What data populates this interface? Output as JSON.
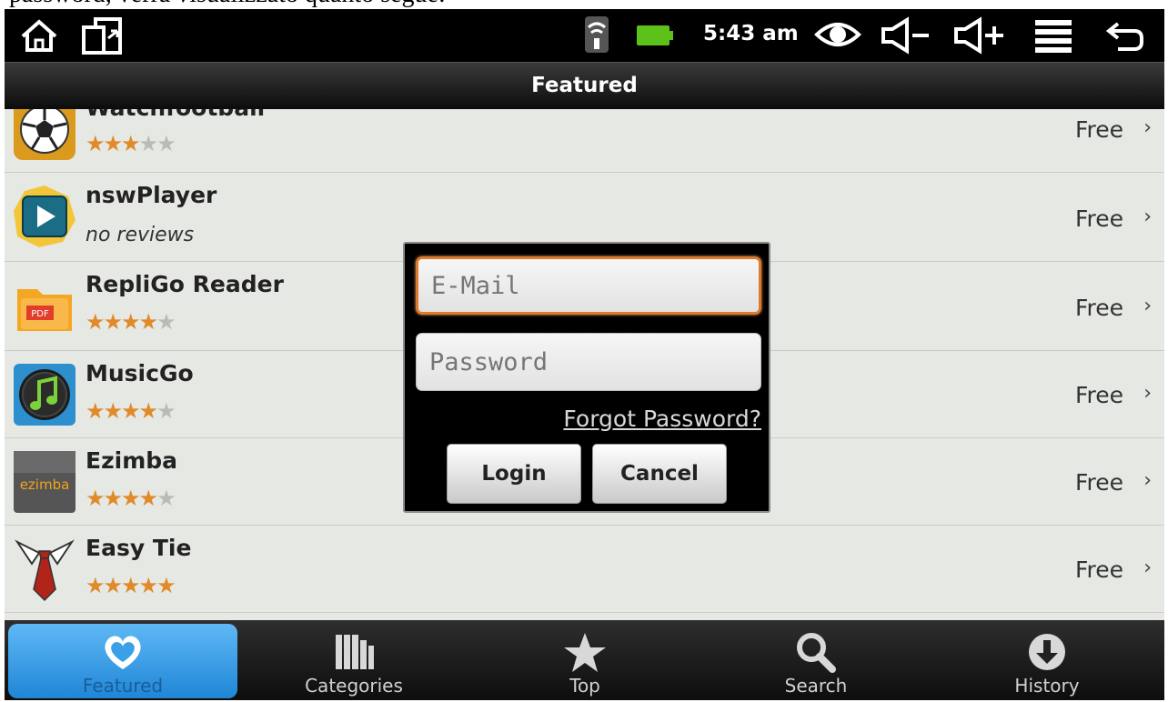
{
  "caption": "password, verrà visualizzato quanto segue:",
  "status": {
    "time": "5:43 am",
    "icons": [
      "home-icon",
      "recent-apps-icon",
      "wifi-icon",
      "battery-icon",
      "eye-icon",
      "volume-down-icon",
      "volume-up-icon",
      "menu-icon",
      "back-icon"
    ]
  },
  "title": "Featured",
  "apps": [
    {
      "name": "Watchfootball",
      "sub": "",
      "rating": 3,
      "price": "Free",
      "chevron": "›",
      "icon": "football-icon"
    },
    {
      "name": "nswPlayer",
      "sub": "no reviews",
      "rating": 0,
      "price": "Free",
      "chevron": "›",
      "icon": "play-icon"
    },
    {
      "name": "RepliGo Reader",
      "sub": "",
      "rating": 4,
      "price": "Free",
      "chevron": "›",
      "icon": "pdf-folder-icon",
      "icon_text": "PDF"
    },
    {
      "name": "MusicGo",
      "sub": "",
      "rating": 4,
      "price": "Free",
      "chevron": "›",
      "icon": "music-note-icon"
    },
    {
      "name": "Ezimba",
      "sub": "",
      "rating": 4,
      "price": "Free",
      "chevron": "›",
      "icon": "ezimba-logo-icon",
      "icon_text": "ezimba"
    },
    {
      "name": "Easy Tie",
      "sub": "",
      "rating": 5,
      "price": "Free",
      "chevron": "›",
      "icon": "tie-icon"
    }
  ],
  "login": {
    "email_placeholder": "E-Mail",
    "email_value": "",
    "password_placeholder": "Password",
    "password_value": "",
    "forgot": "Forgot Password?",
    "login_label": "Login",
    "cancel_label": "Cancel"
  },
  "tabs": [
    {
      "label": "Featured",
      "icon": "heart-icon",
      "active": true
    },
    {
      "label": "Categories",
      "icon": "books-icon",
      "active": false
    },
    {
      "label": "Top",
      "icon": "star-icon",
      "active": false
    },
    {
      "label": "Search",
      "icon": "search-icon",
      "active": false
    },
    {
      "label": "History",
      "icon": "download-icon",
      "active": false
    }
  ],
  "colors": {
    "accent": "#e08a2a",
    "focus_border": "#e07a2a",
    "active_tab": "#3aa0e8",
    "list_bg": "#e6e8e4"
  }
}
